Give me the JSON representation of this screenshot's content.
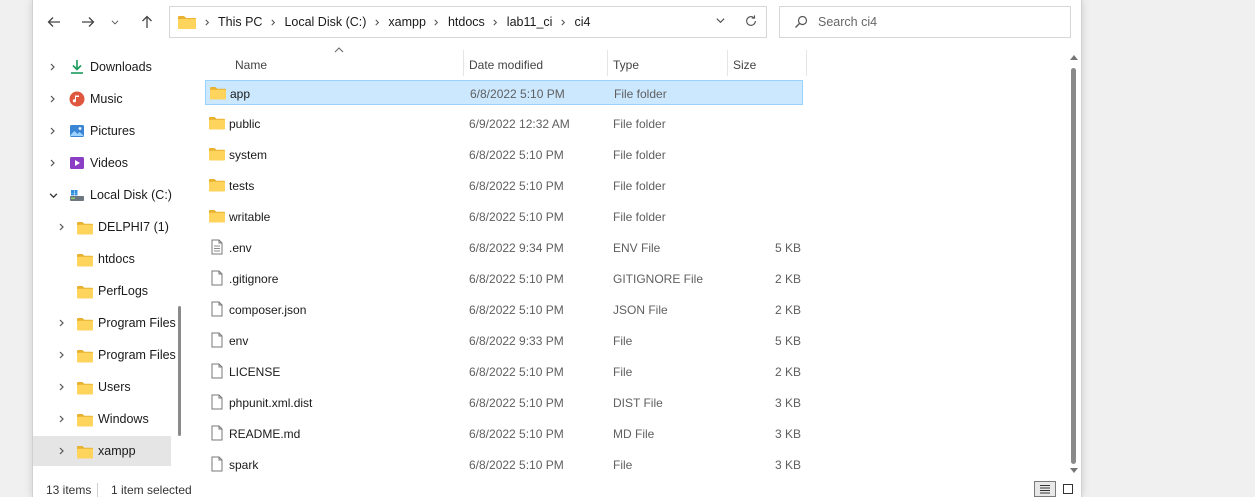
{
  "toolbar": {
    "breadcrumbs": [
      "This PC",
      "Local Disk (C:)",
      "xampp",
      "htdocs",
      "lab11_ci",
      "ci4"
    ],
    "search_placeholder": "Search ci4"
  },
  "sidebar": {
    "items": [
      {
        "label": "Downloads",
        "icon": "download-icon",
        "expandable": true
      },
      {
        "label": "Music",
        "icon": "music-icon",
        "expandable": true
      },
      {
        "label": "Pictures",
        "icon": "pictures-icon",
        "expandable": true
      },
      {
        "label": "Videos",
        "icon": "videos-icon",
        "expandable": true
      },
      {
        "label": "Local Disk (C:)",
        "icon": "drive-icon",
        "expandable": true,
        "expanded": true
      },
      {
        "label": "DELPHI7 (1)",
        "icon": "folder-icon",
        "expandable": true
      },
      {
        "label": "htdocs",
        "icon": "folder-icon",
        "expandable": false
      },
      {
        "label": "PerfLogs",
        "icon": "folder-icon",
        "expandable": false
      },
      {
        "label": "Program Files",
        "icon": "folder-icon",
        "expandable": true
      },
      {
        "label": "Program Files",
        "icon": "folder-icon",
        "expandable": true
      },
      {
        "label": "Users",
        "icon": "folder-icon",
        "expandable": true
      },
      {
        "label": "Windows",
        "icon": "folder-icon",
        "expandable": true
      },
      {
        "label": "xampp",
        "icon": "folder-icon",
        "expandable": true,
        "selected": true
      }
    ]
  },
  "columns": {
    "name": "Name",
    "date": "Date modified",
    "type": "Type",
    "size": "Size"
  },
  "files": [
    {
      "name": "app",
      "date": "6/8/2022 5:10 PM",
      "type": "File folder",
      "size": "",
      "kind": "folder",
      "selected": true
    },
    {
      "name": "public",
      "date": "6/9/2022 12:32 AM",
      "type": "File folder",
      "size": "",
      "kind": "folder"
    },
    {
      "name": "system",
      "date": "6/8/2022 5:10 PM",
      "type": "File folder",
      "size": "",
      "kind": "folder"
    },
    {
      "name": "tests",
      "date": "6/8/2022 5:10 PM",
      "type": "File folder",
      "size": "",
      "kind": "folder"
    },
    {
      "name": "writable",
      "date": "6/8/2022 5:10 PM",
      "type": "File folder",
      "size": "",
      "kind": "folder"
    },
    {
      "name": ".env",
      "date": "6/8/2022 9:34 PM",
      "type": "ENV File",
      "size": "5 KB",
      "kind": "text-file"
    },
    {
      "name": ".gitignore",
      "date": "6/8/2022 5:10 PM",
      "type": "GITIGNORE File",
      "size": "2 KB",
      "kind": "file"
    },
    {
      "name": "composer.json",
      "date": "6/8/2022 5:10 PM",
      "type": "JSON File",
      "size": "2 KB",
      "kind": "file"
    },
    {
      "name": "env",
      "date": "6/8/2022 9:33 PM",
      "type": "File",
      "size": "5 KB",
      "kind": "file"
    },
    {
      "name": "LICENSE",
      "date": "6/8/2022 5:10 PM",
      "type": "File",
      "size": "2 KB",
      "kind": "file"
    },
    {
      "name": "phpunit.xml.dist",
      "date": "6/8/2022 5:10 PM",
      "type": "DIST File",
      "size": "3 KB",
      "kind": "file"
    },
    {
      "name": "README.md",
      "date": "6/8/2022 5:10 PM",
      "type": "MD File",
      "size": "3 KB",
      "kind": "file"
    },
    {
      "name": "spark",
      "date": "6/8/2022 5:10 PM",
      "type": "File",
      "size": "3 KB",
      "kind": "file"
    }
  ],
  "status": {
    "count": "13 items",
    "selection": "1 item selected"
  },
  "colors": {
    "selection_bg": "#cce8ff",
    "selection_border": "#99d1ff",
    "folder_yellow": "#ffd45c",
    "folder_dark": "#e8b230"
  }
}
